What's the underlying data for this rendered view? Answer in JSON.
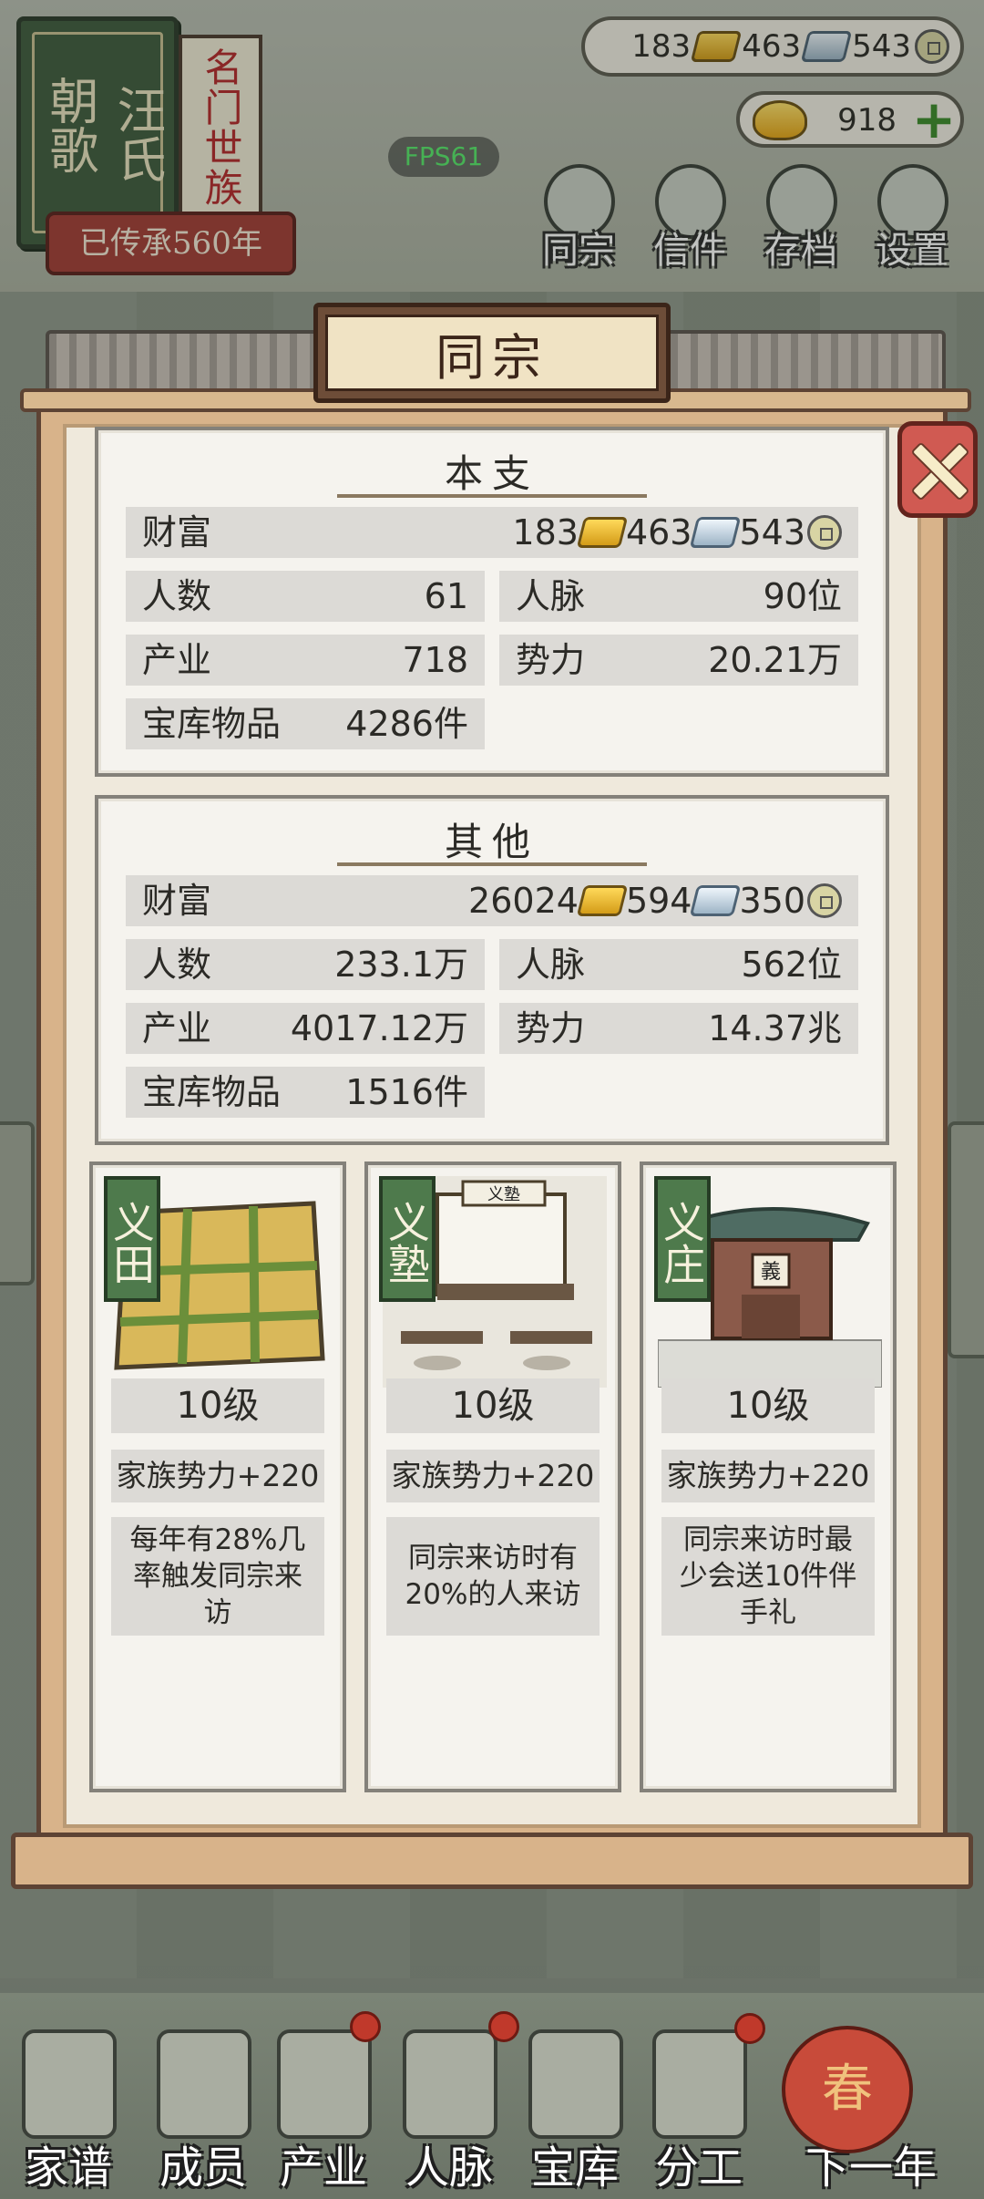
{
  "family": {
    "name_left": "朝歌",
    "name_right": "汪氏",
    "rank": "名门世族",
    "heritage": "已传承560年"
  },
  "currency": {
    "gold": "183",
    "silver": "463",
    "copper": "543",
    "yuanbao": "918"
  },
  "fps": "FPS61",
  "top_menu": [
    {
      "label": "同宗",
      "icon": "clan-book-icon"
    },
    {
      "label": "信件",
      "icon": "letter-icon"
    },
    {
      "label": "存档",
      "icon": "brush-save-icon"
    },
    {
      "label": "设置",
      "icon": "gear-icon"
    }
  ],
  "modal": {
    "title": "同宗",
    "main_branch": {
      "title": "本支",
      "wealth_label": "财富",
      "wealth_gold": "183",
      "wealth_silver": "463",
      "wealth_copper": "543",
      "people_label": "人数",
      "people": "61",
      "network_label": "人脉",
      "network": "90位",
      "industry_label": "产业",
      "industry": "718",
      "power_label": "势力",
      "power": "20.21万",
      "vault_label": "宝库物品",
      "vault": "4286件"
    },
    "others": {
      "title": "其他",
      "wealth_label": "财富",
      "wealth_gold": "26024",
      "wealth_silver": "594",
      "wealth_copper": "350",
      "people_label": "人数",
      "people": "233.1万",
      "network_label": "人脉",
      "network": "562位",
      "industry_label": "产业",
      "industry": "4017.12万",
      "power_label": "势力",
      "power": "14.37兆",
      "vault_label": "宝库物品",
      "vault": "1516件"
    },
    "buildings": [
      {
        "tag": "义田",
        "level": "10级",
        "bonus": "家族势力+220",
        "desc": "每年有28%几率触发同宗来访"
      },
      {
        "tag": "义塾",
        "sign": "义塾",
        "level": "10级",
        "bonus": "家族势力+220",
        "desc": "同宗来访时有20%的人来访"
      },
      {
        "tag": "义庄",
        "sign": "義",
        "level": "10级",
        "bonus": "家族势力+220",
        "desc": "同宗来访时最少会送10件伴手礼"
      }
    ]
  },
  "bottom_nav": [
    {
      "label": "家谱",
      "icon": "genealogy-book-icon"
    },
    {
      "label": "成员",
      "icon": "member-portrait-icon"
    },
    {
      "label": "产业",
      "icon": "pavilion-icon"
    },
    {
      "label": "人脉",
      "icon": "network-icon"
    },
    {
      "label": "宝库",
      "icon": "treasure-chest-icon"
    },
    {
      "label": "分工",
      "icon": "scroll-icon"
    },
    {
      "label": "下一年",
      "icon": "lantern-icon"
    }
  ],
  "next_year_symbol": "春",
  "colors": {
    "panel_bg": "#f5f3ee",
    "row_bg": "#dcdad6",
    "frame_wood": "#d8b38a",
    "tag_green": "#4e7a4c",
    "close_red": "#d05a52"
  }
}
